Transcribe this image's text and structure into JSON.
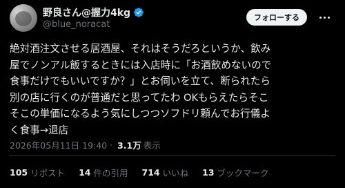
{
  "author": {
    "display_name": "野良さん@握力4kg",
    "handle": "@blue_noracat",
    "verified_icon": "verified-badge-icon",
    "avatar_icon": "cat-avatar"
  },
  "follow_button": {
    "label": "フォローする"
  },
  "more_button": {
    "icon": "more-options-icon"
  },
  "tweet": {
    "text": "絶対酒注文させる居酒屋、それはそうだろというか、飲み\n屋でノンアル飯するときには入店時に「お酒飲めないので\n食事だけでもいいですか？」とお伺いを立て、断られたら\n別の店に行くのが普通だと思ってたわ OKもらえたらそこ\nそこの単価になるよう気にしつつソフドリ頼んでお行儀よ\nく食事→退店"
  },
  "meta": {
    "timestamp": "2026年05月11日 19:40",
    "separator": "·",
    "views_count": "3.1万",
    "views_label": "表示"
  },
  "stats": [
    {
      "count": "105",
      "label": "リポスト"
    },
    {
      "count": "14",
      "label": "件の引用"
    },
    {
      "count": "714",
      "label": "いいね"
    },
    {
      "count": "13",
      "label": "ブックマーク"
    }
  ],
  "colors": {
    "background": "#000000",
    "text": "#e7e9ea",
    "secondary_text": "#71767b",
    "verified": "#1d9bf0",
    "follow_button_bg": "#eff3f4",
    "divider": "#2f3336"
  }
}
